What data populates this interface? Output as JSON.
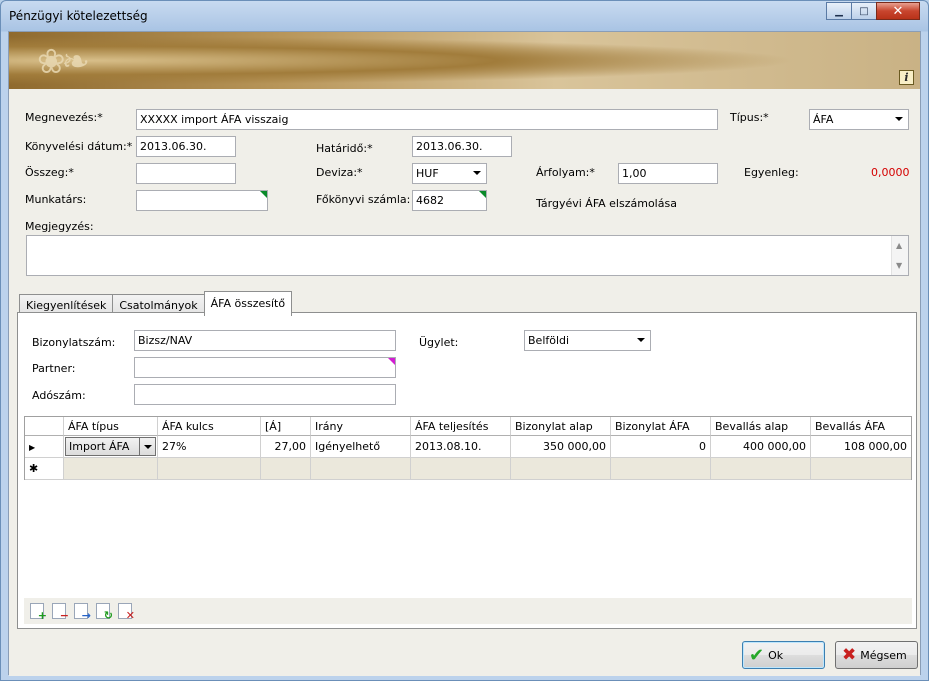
{
  "window": {
    "title": "Pénzügyi kötelezettség"
  },
  "icons": {
    "info": "i",
    "minimize": "▁",
    "maximize": "□",
    "close": "✕",
    "row_current": "▶",
    "row_new": "✱",
    "scroll_up": "▲",
    "scroll_down": "▼"
  },
  "form": {
    "megnevezes_label": "Megnevezés:*",
    "megnevezes_value": "XXXXX import ÁFA visszaig",
    "tipus_label": "Típus:*",
    "tipus_value": "ÁFA",
    "konyvelesi_datum_label": "Könyvelési dátum:*",
    "konyvelesi_datum_value": "2013.06.30.",
    "hatarido_label": "Határidő:*",
    "hatarido_value": "2013.06.30.",
    "osszeg_label": "Összeg:*",
    "osszeg_value": "",
    "deviza_label": "Deviza:*",
    "deviza_value": "HUF",
    "arfolyam_label": "Árfolyam:*",
    "arfolyam_value": "1,00",
    "egyenleg_label": "Egyenleg:",
    "egyenleg_value": "0,0000",
    "munkatars_label": "Munkatárs:",
    "munkatars_value": "",
    "fokonyvi_label": "Főkönyvi számla:",
    "fokonyvi_value": "4682",
    "fokonyvi_desc": "Tárgyévi ÁFA elszámolása",
    "megjegyzes_label": "Megjegyzés:"
  },
  "tabs": [
    "Kiegyenlítések",
    "Csatolmányok",
    "ÁFA összesítő"
  ],
  "afa": {
    "bizonylatszam_label": "Bizonylatszám:",
    "bizonylatszam_value": "Bizsz/NAV",
    "ugylet_label": "Ügylet:",
    "ugylet_value": "Belföldi",
    "partner_label": "Partner:",
    "partner_value": "",
    "adoszam_label": "Adószám:",
    "adoszam_value": ""
  },
  "grid": {
    "headers": [
      "ÁFA típus",
      "ÁFA kulcs",
      "[Á]",
      "Irány",
      "ÁFA teljesítés",
      "Bizonylat alap",
      "Bizonylat ÁFA",
      "Bevallás alap",
      "Bevallás ÁFA"
    ],
    "row": [
      "Import ÁFA",
      "27%",
      "27,00",
      "Igényelhető",
      "2013.08.10.",
      "350 000,00",
      "0",
      "400 000,00",
      "108 000,00"
    ]
  },
  "buttons": {
    "ok": "Ok",
    "cancel": "Mégsem"
  }
}
